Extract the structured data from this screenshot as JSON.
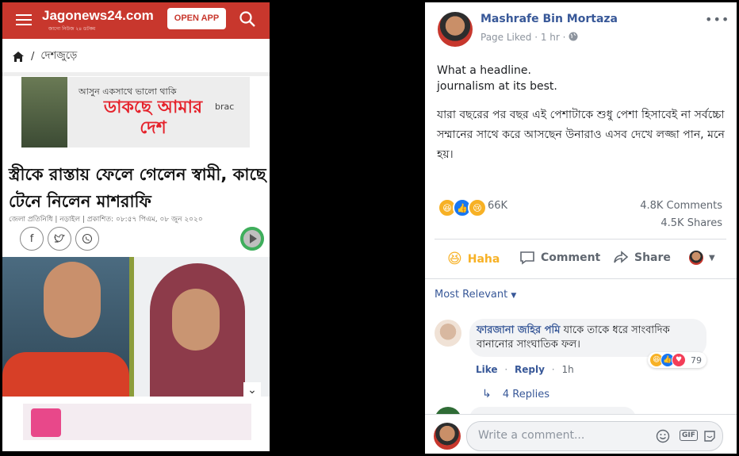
{
  "left": {
    "logo": "Jagonews24.com",
    "logo_tagline": "জাগো নিউজ ২৪ ডটকম",
    "open_app": "OPEN APP",
    "breadcrumb": {
      "separator": "/",
      "section": "দেশজুড়ে"
    },
    "ad": {
      "line1": "আসুন একসাথে ভালো থাকি",
      "line2": "ডাকছে আমার দেশ",
      "brand": "brac"
    },
    "headline": "স্ত্রীকে রাস্তায় ফেলে গেলেন স্বামী, কাছে টেনে নিলেন মাশরাফি",
    "meta": "জেলা প্রতিনিধি | নড়াইল | প্রকাশিত: ০৮:৫৭ পিএম, ০৮ জুন ২০২০",
    "share_icons": [
      "facebook-icon",
      "twitter-icon",
      "whatsapp-icon"
    ]
  },
  "post": {
    "author": "Mashrafe Bin Mortaza",
    "meta": "Page Liked · 1 hr ·",
    "text_line1": "What a headline.",
    "text_line2": "journalism at its best.",
    "text_bangla": "যারা বছরের পর বছর এই পেশাটাকে শুধু পেশা হিসাবেই না সর্বচ্চো সম্মানের সাথে করে আসছেন উনারাও এসব দেখে লজ্জা পান, মনে হয়।",
    "reaction_count": "66K",
    "comments_count": "4.8K Comments",
    "shares_count": "4.5K Shares",
    "actions": {
      "haha": "Haha",
      "comment": "Comment",
      "share": "Share"
    },
    "reaction_colors": {
      "haha": "#f7b125",
      "like": "#1877f2",
      "sad": "#f7b125"
    }
  },
  "comments": {
    "sort": "Most Relevant",
    "items": [
      {
        "name": "ফারজানা জহির পমি",
        "text": "যাকে তাকে ধরে সাংবাদিক বানানোর সাংঘাতিক ফল।",
        "reaction_count": "79",
        "like": "Like",
        "reply": "Reply",
        "time": "1h",
        "replies": "4 Replies"
      }
    ]
  },
  "write_comment": {
    "placeholder": "Write a comment...",
    "gif": "GIF"
  }
}
